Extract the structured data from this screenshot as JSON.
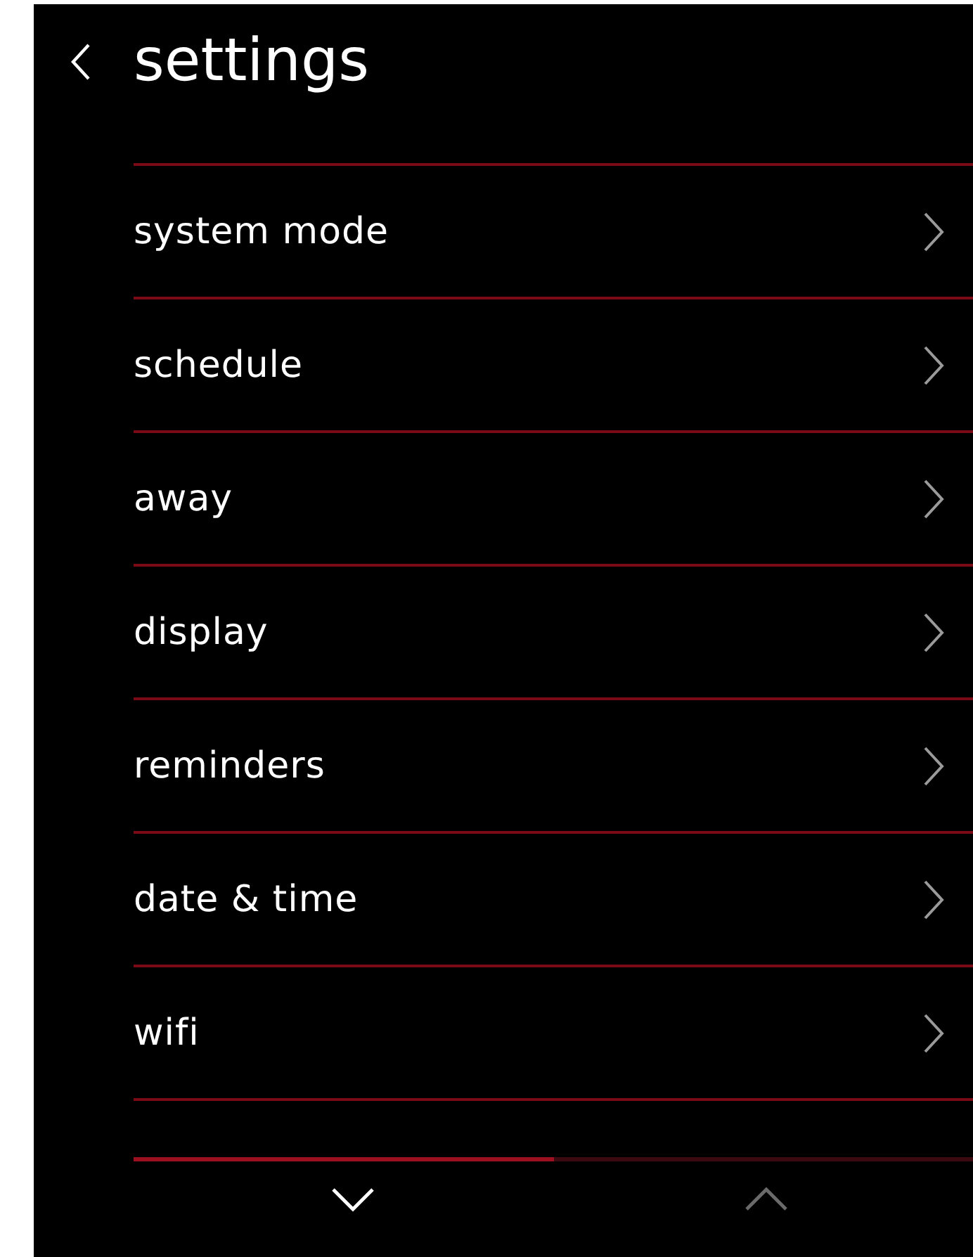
{
  "header": {
    "title": "settings"
  },
  "items": [
    {
      "label": "system mode"
    },
    {
      "label": "schedule"
    },
    {
      "label": "away"
    },
    {
      "label": "display"
    },
    {
      "label": "reminders"
    },
    {
      "label": "date & time"
    },
    {
      "label": "wifi"
    }
  ],
  "pager": {
    "down_disabled": false,
    "up_disabled": true,
    "level": 0.5
  }
}
